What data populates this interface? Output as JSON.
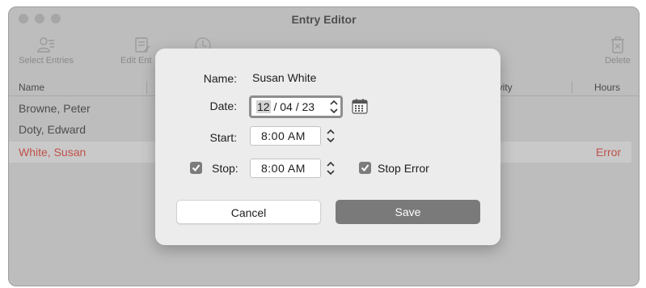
{
  "window": {
    "title": "Entry Editor"
  },
  "toolbar": {
    "select_entries": "Select Entries",
    "edit_entry": "Edit Ent",
    "delete": "Delete"
  },
  "table": {
    "columns": [
      "Name",
      "ivity",
      "Hours"
    ],
    "rows": [
      {
        "name": "Browne, Peter",
        "hours": ""
      },
      {
        "name": "Doty, Edward",
        "hours": ""
      },
      {
        "name": "White, Susan",
        "hours": "Error"
      }
    ]
  },
  "dialog": {
    "name_label": "Name:",
    "name_value": "Susan White",
    "date_label": "Date:",
    "date_month": "12",
    "date_day": "04",
    "date_year": "23",
    "start_label": "Start:",
    "start_value": "8:00 AM",
    "stop_label": "Stop:",
    "stop_value": "8:00 AM",
    "stop_checked": true,
    "stop_error_label": "Stop Error",
    "stop_error_checked": true,
    "cancel_label": "Cancel",
    "save_label": "Save"
  },
  "icons": {
    "select_entries": "people-list-icon",
    "edit_entry": "edit-document-icon",
    "clock": "clock-icon",
    "delete": "trash-icon",
    "calendar": "calendar-icon",
    "stepper": "stepper-icon",
    "checkbox": "checkmark-icon"
  },
  "colors": {
    "error_text": "#c0524a",
    "save_button": "#7a7a7a",
    "selected_row": "#c9c9c9"
  }
}
